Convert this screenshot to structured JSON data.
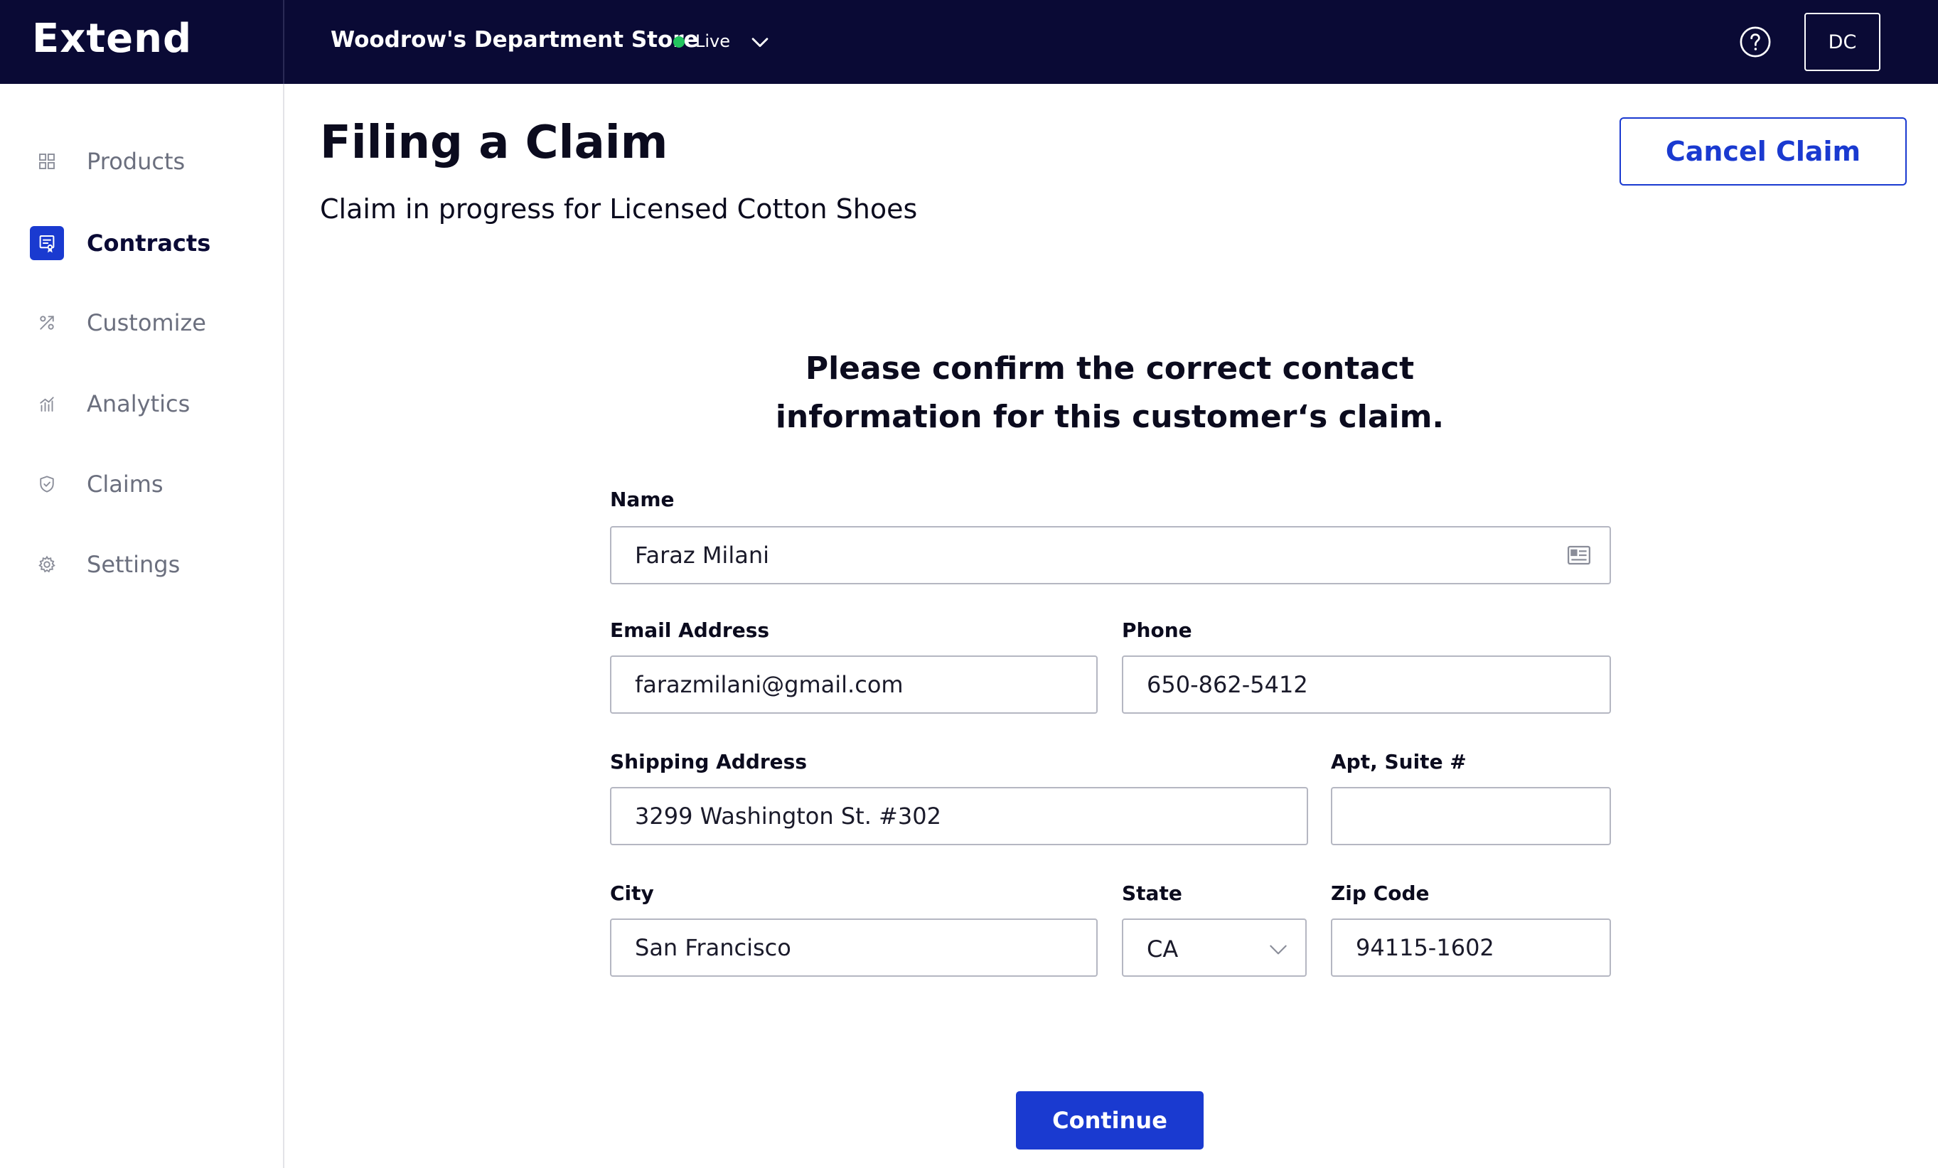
{
  "header": {
    "brand": "Extend",
    "store_name": "Woodrow's Department Store",
    "env_label": "Live",
    "env_color": "#22c55e",
    "avatar_initials": "DC"
  },
  "sidebar": {
    "items": [
      {
        "label": "Products",
        "icon": "grid-icon",
        "active": false
      },
      {
        "label": "Contracts",
        "icon": "contract-icon",
        "active": true
      },
      {
        "label": "Customize",
        "icon": "tools-icon",
        "active": false
      },
      {
        "label": "Analytics",
        "icon": "chart-icon",
        "active": false
      },
      {
        "label": "Claims",
        "icon": "shield-icon",
        "active": false
      },
      {
        "label": "Settings",
        "icon": "gear-icon",
        "active": false
      }
    ]
  },
  "main": {
    "title": "Filing a Claim",
    "subtitle": "Claim in progress for Licensed Cotton Shoes",
    "cancel_label": "Cancel Claim"
  },
  "form": {
    "heading_line1": "Please confirm the correct contact",
    "heading_line2": "information for this customer‘s claim.",
    "name": {
      "label": "Name",
      "value": "Faraz Milani"
    },
    "email": {
      "label": "Email Address",
      "value": "farazmilani@gmail.com"
    },
    "phone": {
      "label": "Phone",
      "value": "650-862-5412"
    },
    "shipping": {
      "label": "Shipping Address",
      "value": "3299 Washington St. #302"
    },
    "apt": {
      "label": "Apt, Suite #",
      "value": ""
    },
    "city": {
      "label": "City",
      "value": "San Francisco"
    },
    "state": {
      "label": "State",
      "value": "CA"
    },
    "zip": {
      "label": "Zip Code",
      "value": "94115-1602"
    },
    "continue_label": "Continue"
  },
  "colors": {
    "topbar": "#0a0a35",
    "accent": "#1a3ad0"
  }
}
